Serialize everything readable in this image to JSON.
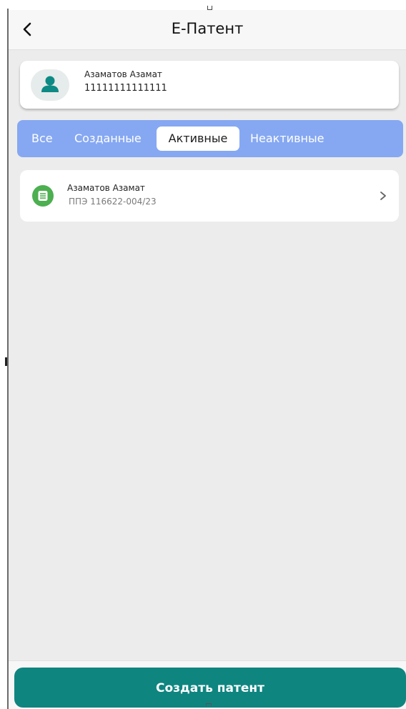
{
  "header": {
    "title": "Е-Патент",
    "back_icon": "chevron-left-icon"
  },
  "profile": {
    "name": "Азаматов Азамат",
    "id": "11111111111111",
    "avatar_icon": "user-icon"
  },
  "tabs": [
    {
      "label": "Все",
      "active": false
    },
    {
      "label": "Созданные",
      "active": false
    },
    {
      "label": "Активные",
      "active": true
    },
    {
      "label": "Неактивные",
      "active": false
    }
  ],
  "patents": [
    {
      "name": "Азаматов Азамат",
      "number": "ППЭ 116622-004/23",
      "icon": "document-icon",
      "chevron_icon": "chevron-right-icon"
    }
  ],
  "footer": {
    "create_button_label": "Создать патент"
  },
  "colors": {
    "accent_teal": "#0f8580",
    "tabs_bg": "#86a8f2",
    "doc_icon_green": "#4caf50",
    "content_bg": "#ececec"
  }
}
